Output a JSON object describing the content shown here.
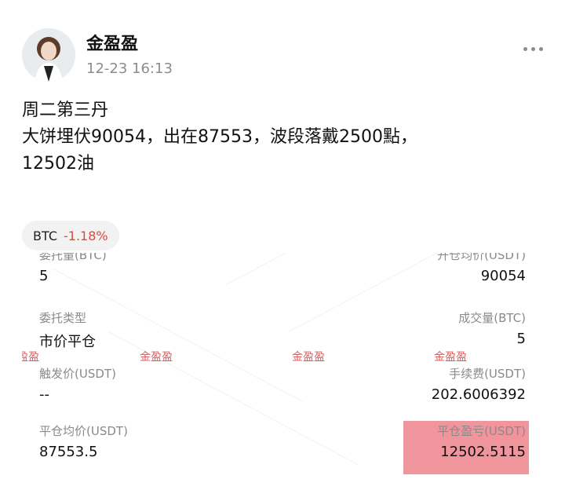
{
  "post": {
    "username": "金盈盈",
    "timestamp": "12-23 16:13",
    "lines": [
      "周二第三丹",
      "大饼埋伏90054，出在87553，波段落戴2500點，",
      "12502油"
    ]
  },
  "ticker": {
    "symbol": "BTC",
    "change": "-1.18%"
  },
  "order": {
    "entrust_qty_label": "委托量(BTC)",
    "entrust_qty": "5",
    "avg_open_label": "开仓均价(USDT)",
    "avg_open": "90054",
    "entrust_type_label": "委托类型",
    "entrust_type": "市价平仓",
    "filled_label": "成交量(BTC)",
    "filled": "5",
    "trigger_label": "触发价(USDT)",
    "trigger": "--",
    "right3_label": "手续费(USDT)",
    "right3": "202.6006392",
    "close_avg_label": "平仓均价(USDT)",
    "close_avg": "87553.5",
    "pnl_label": "平仓盈亏(USDT)",
    "pnl": "12502.5115",
    "highlight_color": "#f08a92"
  },
  "watermarks": [
    "盈盈",
    "金盈盈",
    "金盈盈",
    "金盈盈"
  ],
  "icons": {
    "more": "more-dots-icon"
  }
}
